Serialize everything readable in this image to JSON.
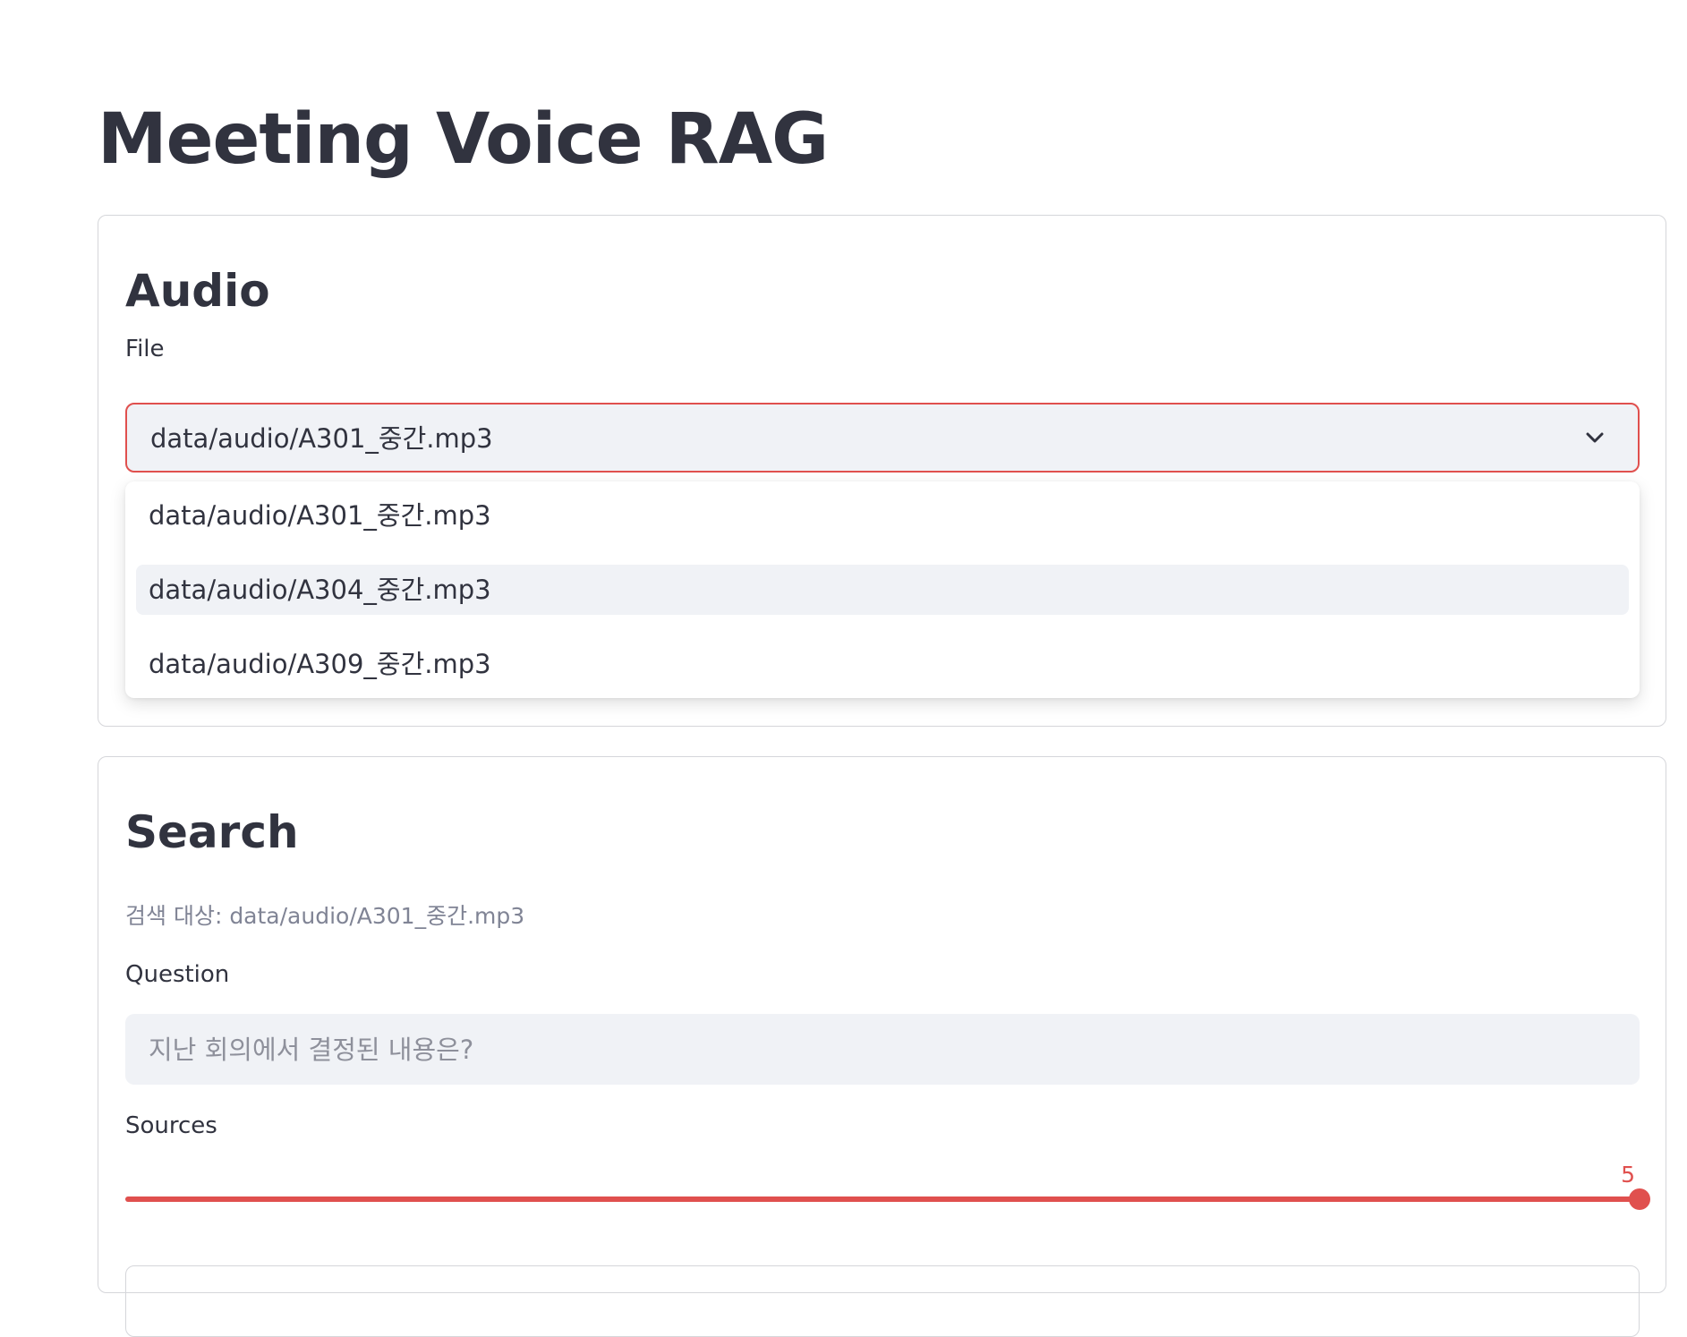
{
  "page": {
    "title": "Meeting Voice RAG"
  },
  "audio": {
    "heading": "Audio",
    "file_label": "File",
    "selected_file": "data/audio/A301_중간.mp3",
    "options": [
      "data/audio/A301_중간.mp3",
      "data/audio/A304_중간.mp3",
      "data/audio/A309_중간.mp3"
    ],
    "highlighted_option_index": 1
  },
  "search": {
    "heading": "Search",
    "caption": "검색 대상: data/audio/A301_중간.mp3",
    "question_label": "Question",
    "question_value": "",
    "question_placeholder": "지난 회의에서 결정된 내용은?",
    "sources_label": "Sources",
    "sources_value": "5",
    "sources_fraction": 1.0
  },
  "colors": {
    "accent": "#e0504e",
    "text": "#31333f",
    "muted": "#808495",
    "input_bg": "#f0f2f6",
    "border": "#d5d6da"
  },
  "icons": {
    "select_chevron": "chevron-down-icon"
  }
}
